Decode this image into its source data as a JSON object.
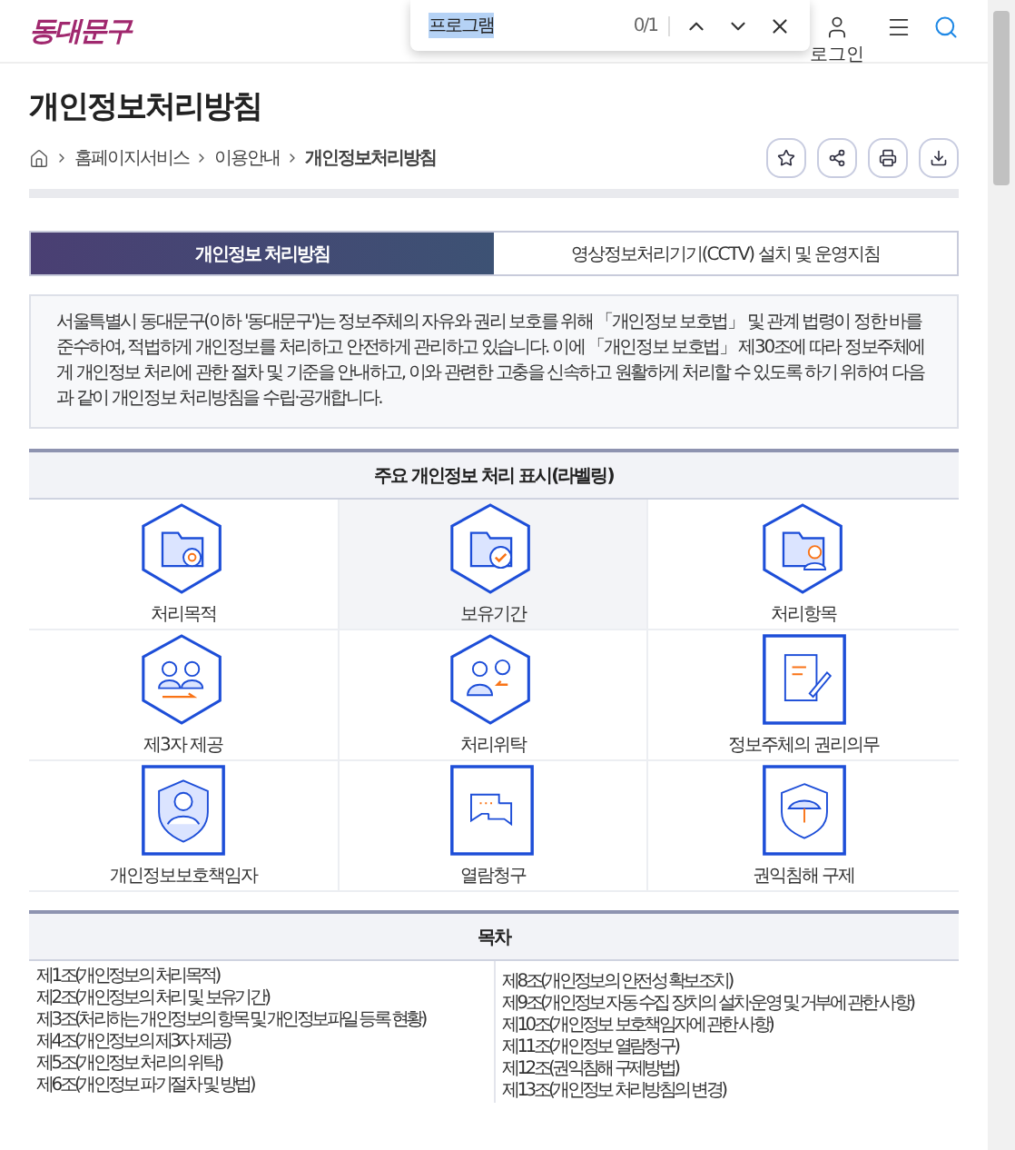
{
  "header": {
    "logo": "동대문구",
    "login": "로그인"
  },
  "find_bar": {
    "query": "프로그램",
    "count": "0/1"
  },
  "page": {
    "title": "개인정보처리방침",
    "breadcrumb": [
      "홈페이지서비스",
      "이용안내",
      "개인정보처리방침"
    ]
  },
  "tabs": [
    {
      "label": "개인정보 처리방침",
      "selected": true
    },
    {
      "label": "영상정보처리기기(CCTV) 설치 및 운영지침",
      "selected": false
    }
  ],
  "intro": "서울특별시 동대문구(이하 '동대문구')는 정보주체의 자유와 권리 보호를 위해 「개인정보 보호법」 및 관계 법령이 정한 바를 준수하여, 적법하게 개인정보를 처리하고 안전하게 관리하고 있습니다. 이에 「개인정보 보호법」 제30조에 따라 정보주체에게 개인정보 처리에 관한 절차 및 기준을 안내하고, 이와 관련한 고충을 신속하고 원활하게 처리할 수 있도록 하기 위하여 다음과 같이 개인정보 처리방침을 수립·공개합니다.",
  "labeling": {
    "title": "주요 개인정보 처리 표시(라벨링)",
    "items": [
      {
        "label": "처리목적",
        "kind": "hexagon",
        "selected": false
      },
      {
        "label": "보유기간",
        "kind": "hexagon",
        "selected": true
      },
      {
        "label": "처리항목",
        "kind": "hexagon",
        "selected": false
      },
      {
        "label": "제3자 제공",
        "kind": "hexagon",
        "selected": false
      },
      {
        "label": "처리위탁",
        "kind": "hexagon",
        "selected": false
      },
      {
        "label": "정보주체의 권리의무",
        "kind": "square",
        "selected": false
      },
      {
        "label": "개인정보보호책임자",
        "kind": "square",
        "selected": false
      },
      {
        "label": "열람청구",
        "kind": "square",
        "selected": false
      },
      {
        "label": "권익침해 구제",
        "kind": "square",
        "selected": false
      }
    ]
  },
  "toc": {
    "title": "목차",
    "left": [
      "제1조(개인정보의 처리목적)",
      "제2조(개인정보의 처리 및 보유기간)",
      "제3조(처리하는 개인정보의 항목 및 개인정보파일 등록 현황)",
      "제4조(개인정보의 제3자 제공)",
      "제5조(개인정보 처리의 위탁)",
      "제6조(개인정보 파기절차 및 방법)"
    ],
    "right": [
      "제8조(개인정보의 안전성 확보조치)",
      "제9조(개인정보 자동 수집 장치의 설치·운영 및 거부에 관한 사항)",
      "제10조(개인정보 보호책임자에 관한 사항)",
      "제11조(개인정보 열람청구)",
      "제12조(권익침해 구제방법)",
      "제13조(개인정보 처리방침의 변경)"
    ]
  }
}
